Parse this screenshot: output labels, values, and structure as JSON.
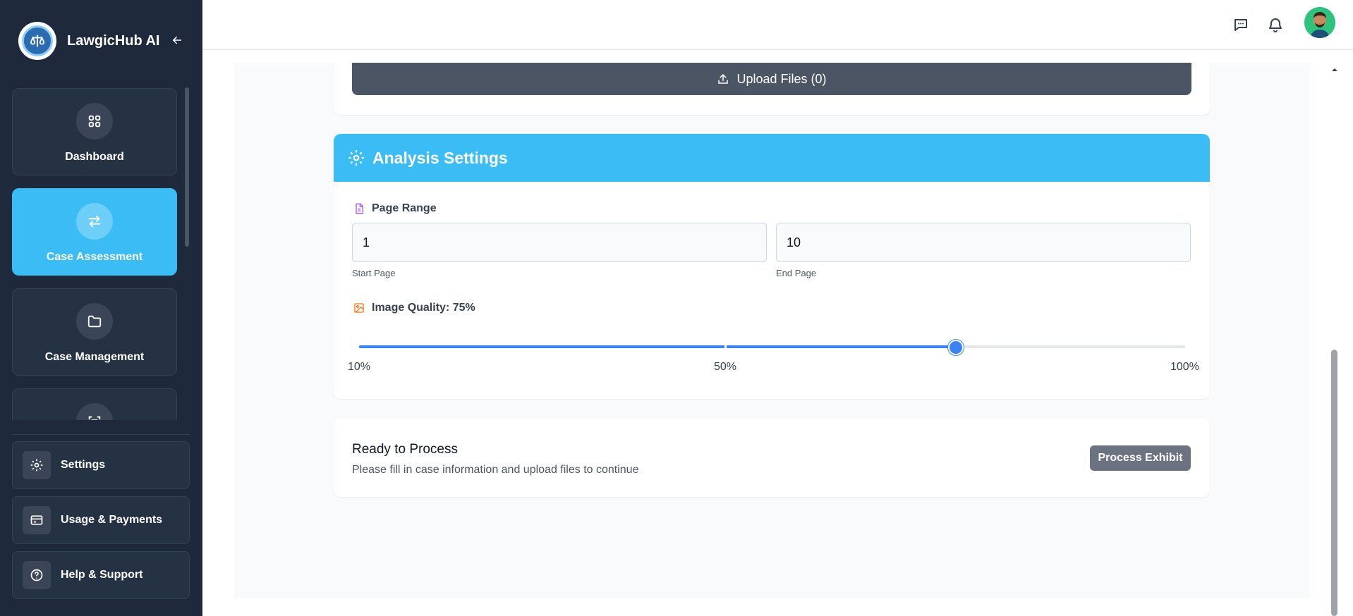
{
  "app": {
    "name": "LawgicHub AI"
  },
  "sidebar": {
    "nav_items": [
      {
        "label": "Dashboard",
        "icon": "grid-icon"
      },
      {
        "label": "Case Assessment",
        "icon": "arrows-swap-icon",
        "active": true
      },
      {
        "label": "Case Management",
        "icon": "folder-icon"
      },
      {
        "label": "",
        "icon": "scan-document-icon"
      }
    ],
    "bottom_items": [
      {
        "label": "Settings",
        "icon": "gear-icon"
      },
      {
        "label": "Usage & Payments",
        "icon": "credit-card-icon"
      },
      {
        "label": "Help & Support",
        "icon": "help-circle-icon"
      }
    ]
  },
  "header": {
    "icons": [
      "chat-icon",
      "bell-icon",
      "avatar"
    ]
  },
  "upload": {
    "button_label": "Upload Files (0)"
  },
  "analysis_settings": {
    "title": "Analysis Settings",
    "page_range": {
      "label": "Page Range",
      "start_value": "1",
      "end_value": "10",
      "start_label": "Start Page",
      "end_label": "End Page"
    },
    "image_quality": {
      "label": "Image Quality: 75%",
      "value": 75,
      "min": 10,
      "max": 100,
      "ticks": [
        "10%",
        "50%",
        "100%"
      ]
    }
  },
  "process": {
    "title": "Ready to Process",
    "description": "Please fill in case information and upload files to continue",
    "button_label": "Process Exhibit"
  },
  "colors": {
    "sidebar_bg": "#1e2a3b",
    "accent": "#3bbcf5",
    "slider": "#3b82f6"
  }
}
